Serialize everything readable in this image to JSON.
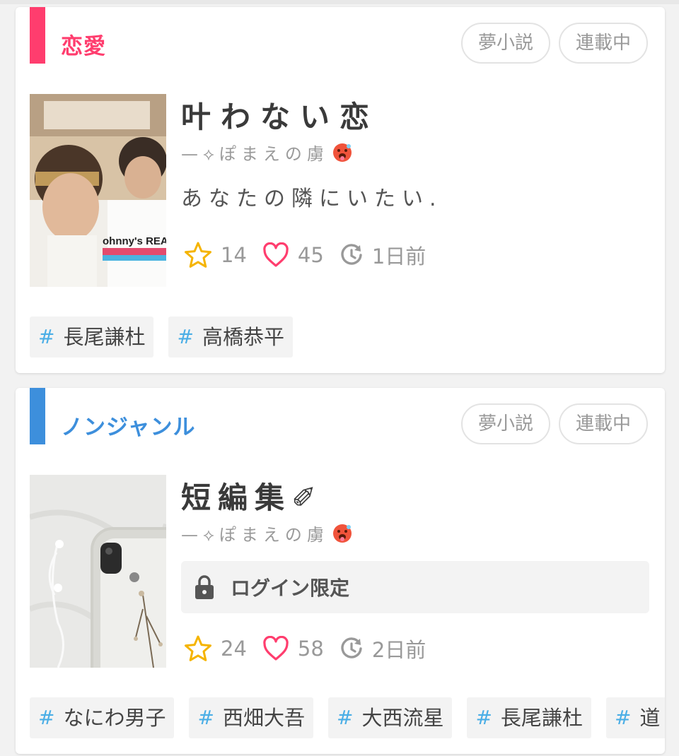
{
  "cards": [
    {
      "genre": "恋愛",
      "genre_color": "#ff3d6e",
      "pills": [
        "夢小説",
        "連載中"
      ],
      "title": "叶わない恋",
      "author": "—⟡ぽまえの虜",
      "author_emoji": "hot-face-emoji",
      "description": "あなたの隣にいたい.",
      "stats": {
        "stars": "14",
        "likes": "45",
        "updated": "1日前"
      },
      "tags": [
        "長尾謙杜",
        "高橋恭平"
      ],
      "thumbnail_text": "ohnny's REAM"
    },
    {
      "genre": "ノンジャンル",
      "genre_color": "#3d8fdc",
      "pills": [
        "夢小説",
        "連載中"
      ],
      "title": "短編集✐",
      "author": "—⟡ぽまえの虜",
      "author_emoji": "hot-face-emoji",
      "locked_label": "ログイン限定",
      "stats": {
        "stars": "24",
        "likes": "58",
        "updated": "2日前"
      },
      "tags": [
        "なにわ男子",
        "西畑大吾",
        "大西流星",
        "長尾謙杜",
        "道"
      ]
    }
  ],
  "icons": {
    "star": "star-icon",
    "heart": "heart-icon",
    "clock": "clock-icon",
    "lock": "lock-icon",
    "hash": "#"
  },
  "colors": {
    "star": "#f5b400",
    "heart": "#ff3d6e",
    "tag_hash": "#4aaee6"
  }
}
